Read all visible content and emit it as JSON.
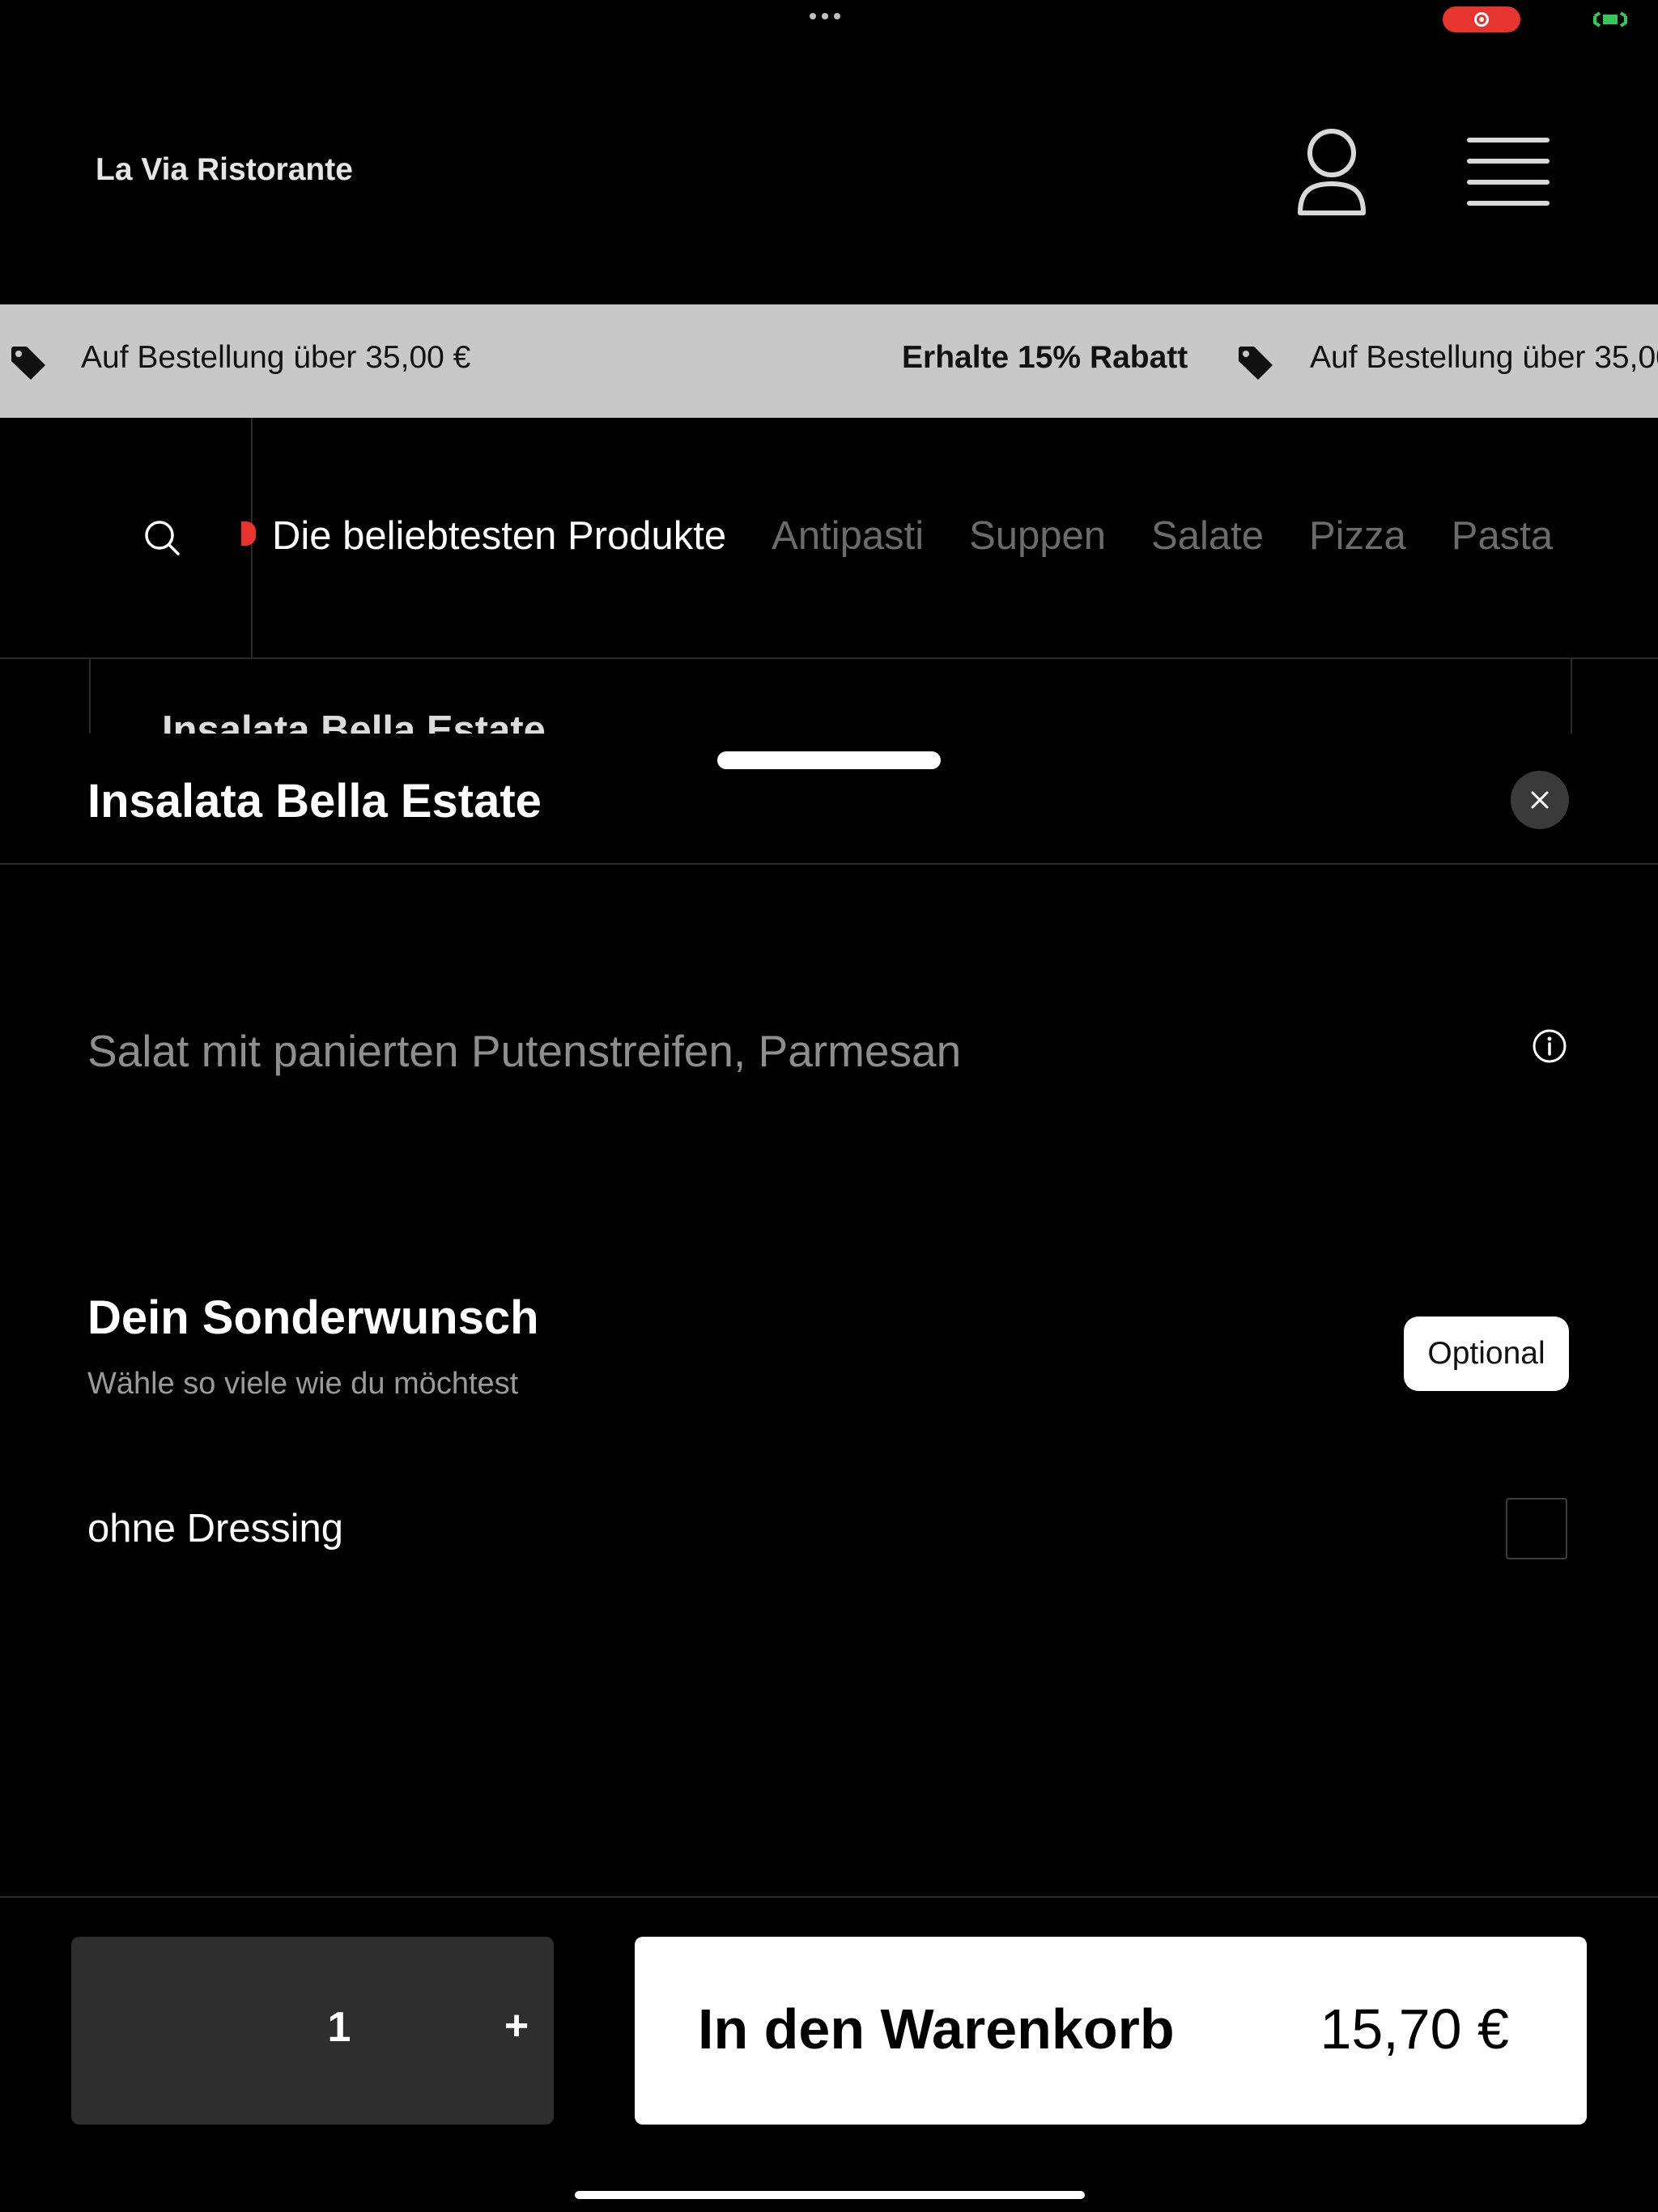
{
  "header": {
    "brand": "La Via Ristorante"
  },
  "promo": {
    "items": [
      "Auf Bestellung über 35,00 €",
      "Erhalte 15% Rabatt",
      "Auf Bestellung über 35,00 €"
    ]
  },
  "categories": {
    "items": [
      "Die beliebtesten Produkte",
      "Antipasti",
      "Suppen",
      "Salate",
      "Pizza",
      "Pasta"
    ],
    "active_index": 0
  },
  "peek": {
    "title": "Insalata Bella Estate"
  },
  "sheet": {
    "title": "Insalata Bella Estate",
    "description": "Salat mit panierten Putenstreifen, Parmesan",
    "options_group": {
      "title": "Dein Sonderwunsch",
      "subtitle": "Wähle so viele wie du möchtest",
      "badge": "Optional",
      "items": [
        {
          "label": "ohne Dressing",
          "checked": false
        }
      ]
    }
  },
  "footer": {
    "quantity": "1",
    "plus_label": "+",
    "add_to_cart_label": "In den Warenkorb",
    "price": "15,70 €"
  },
  "colors": {
    "background": "#000000",
    "accent": "#e8342f",
    "promo_background": "#c8c8c8"
  },
  "icons": [
    "more-dots-icon",
    "record-icon",
    "screen-cast-icon",
    "user-icon",
    "hamburger-menu-icon",
    "price-tag-icon",
    "search-icon",
    "close-icon",
    "info-icon"
  ]
}
